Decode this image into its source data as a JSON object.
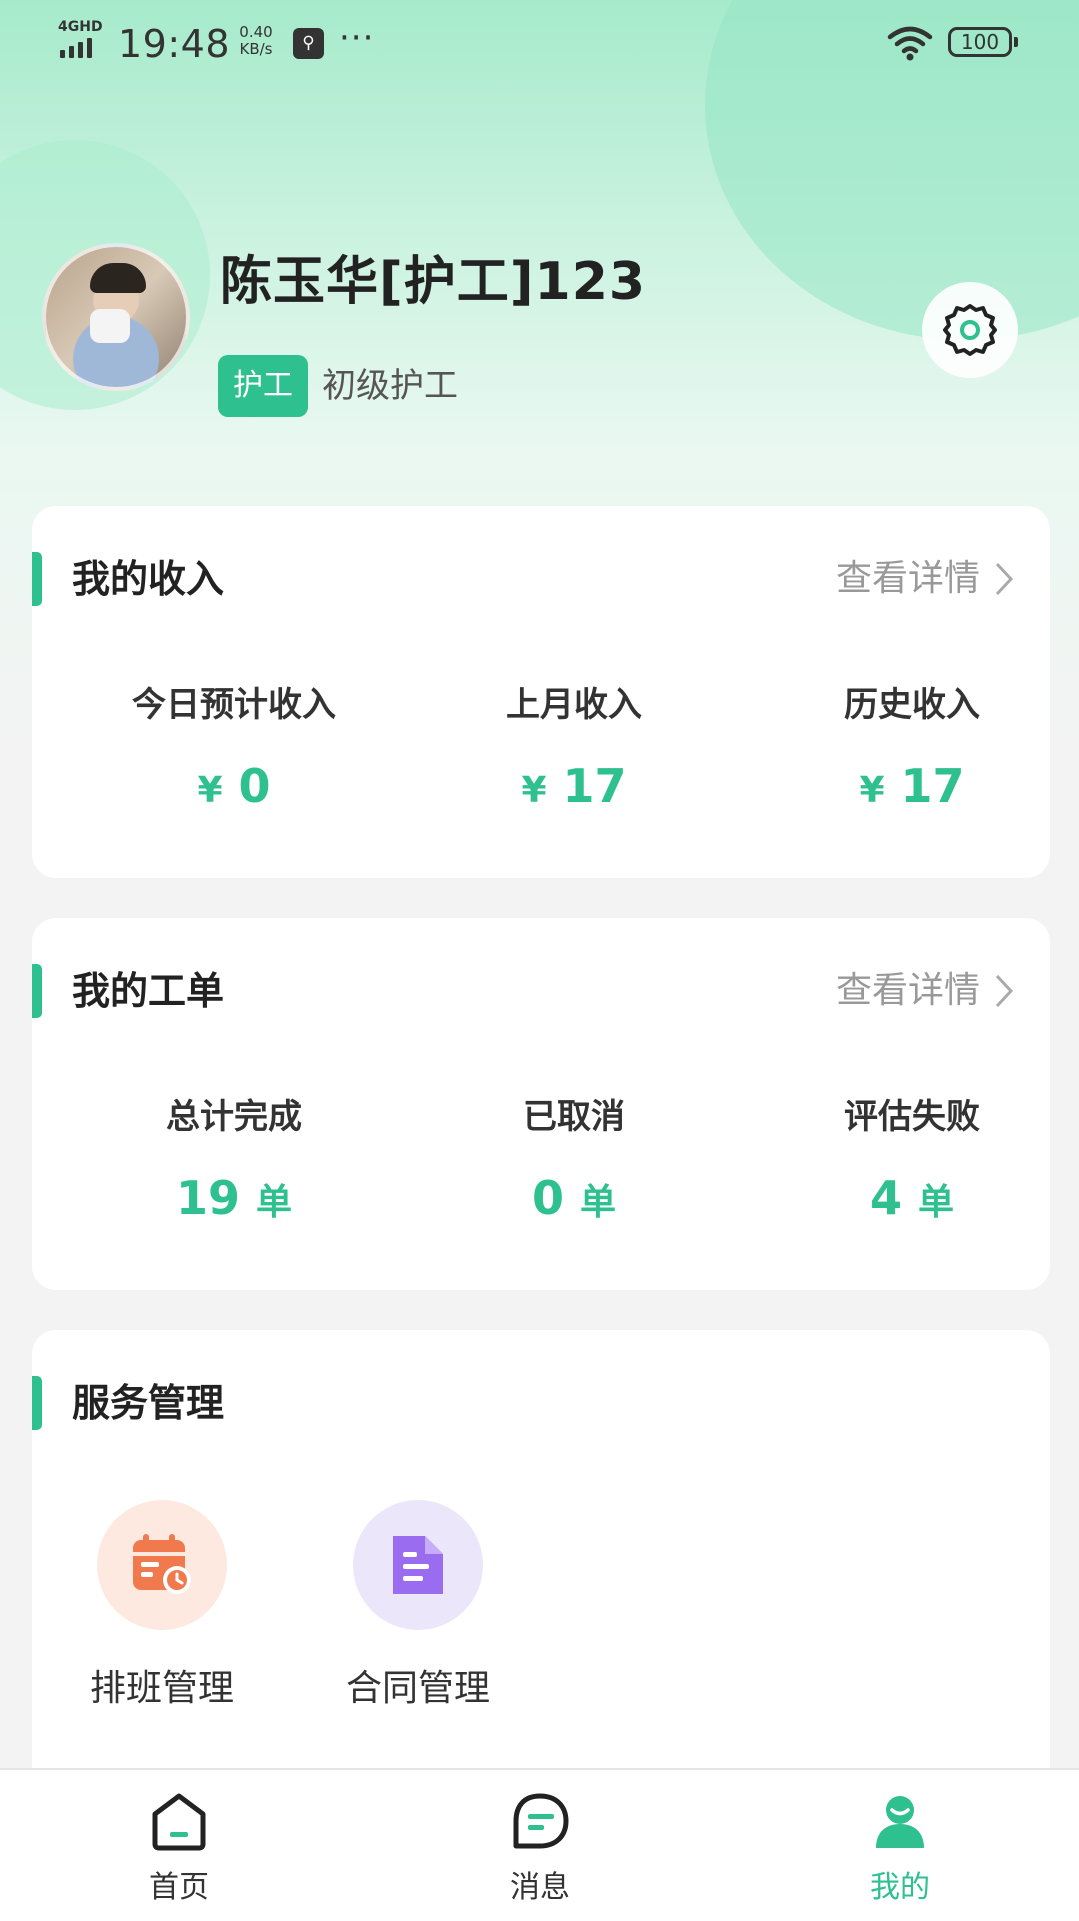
{
  "status_bar": {
    "network": "4GHD",
    "time": "19:48",
    "speed_value": "0.40",
    "speed_unit": "KB/s",
    "more": "···",
    "battery": "100"
  },
  "profile": {
    "name": "陈玉华[护工]123",
    "role_tag": "护工",
    "role_level": "初级护工"
  },
  "income": {
    "title": "我的收入",
    "link": "查看详情",
    "stats": [
      {
        "label": "今日预计收入",
        "prefix": "¥",
        "value": "0"
      },
      {
        "label": "上月收入",
        "prefix": "¥",
        "value": "17"
      },
      {
        "label": "历史收入",
        "prefix": "¥",
        "value": "17"
      }
    ]
  },
  "orders": {
    "title": "我的工单",
    "link": "查看详情",
    "stats": [
      {
        "label": "总计完成",
        "value": "19",
        "unit": "单"
      },
      {
        "label": "已取消",
        "value": "0",
        "unit": "单"
      },
      {
        "label": "评估失败",
        "value": "4",
        "unit": "单"
      }
    ]
  },
  "services": {
    "title": "服务管理",
    "items": [
      {
        "label": "排班管理",
        "icon": "calendar-clock-icon"
      },
      {
        "label": "合同管理",
        "icon": "document-icon"
      }
    ]
  },
  "nav": {
    "items": [
      {
        "label": "首页",
        "icon": "home-icon"
      },
      {
        "label": "消息",
        "icon": "message-icon"
      },
      {
        "label": "我的",
        "icon": "profile-icon",
        "active": true
      }
    ]
  },
  "colors": {
    "accent": "#2ec08e",
    "schedule_bg": "#fde9e0",
    "schedule_icon": "#f07a4e",
    "contract_bg": "#ece6fb",
    "contract_icon": "#9a6cf0"
  }
}
